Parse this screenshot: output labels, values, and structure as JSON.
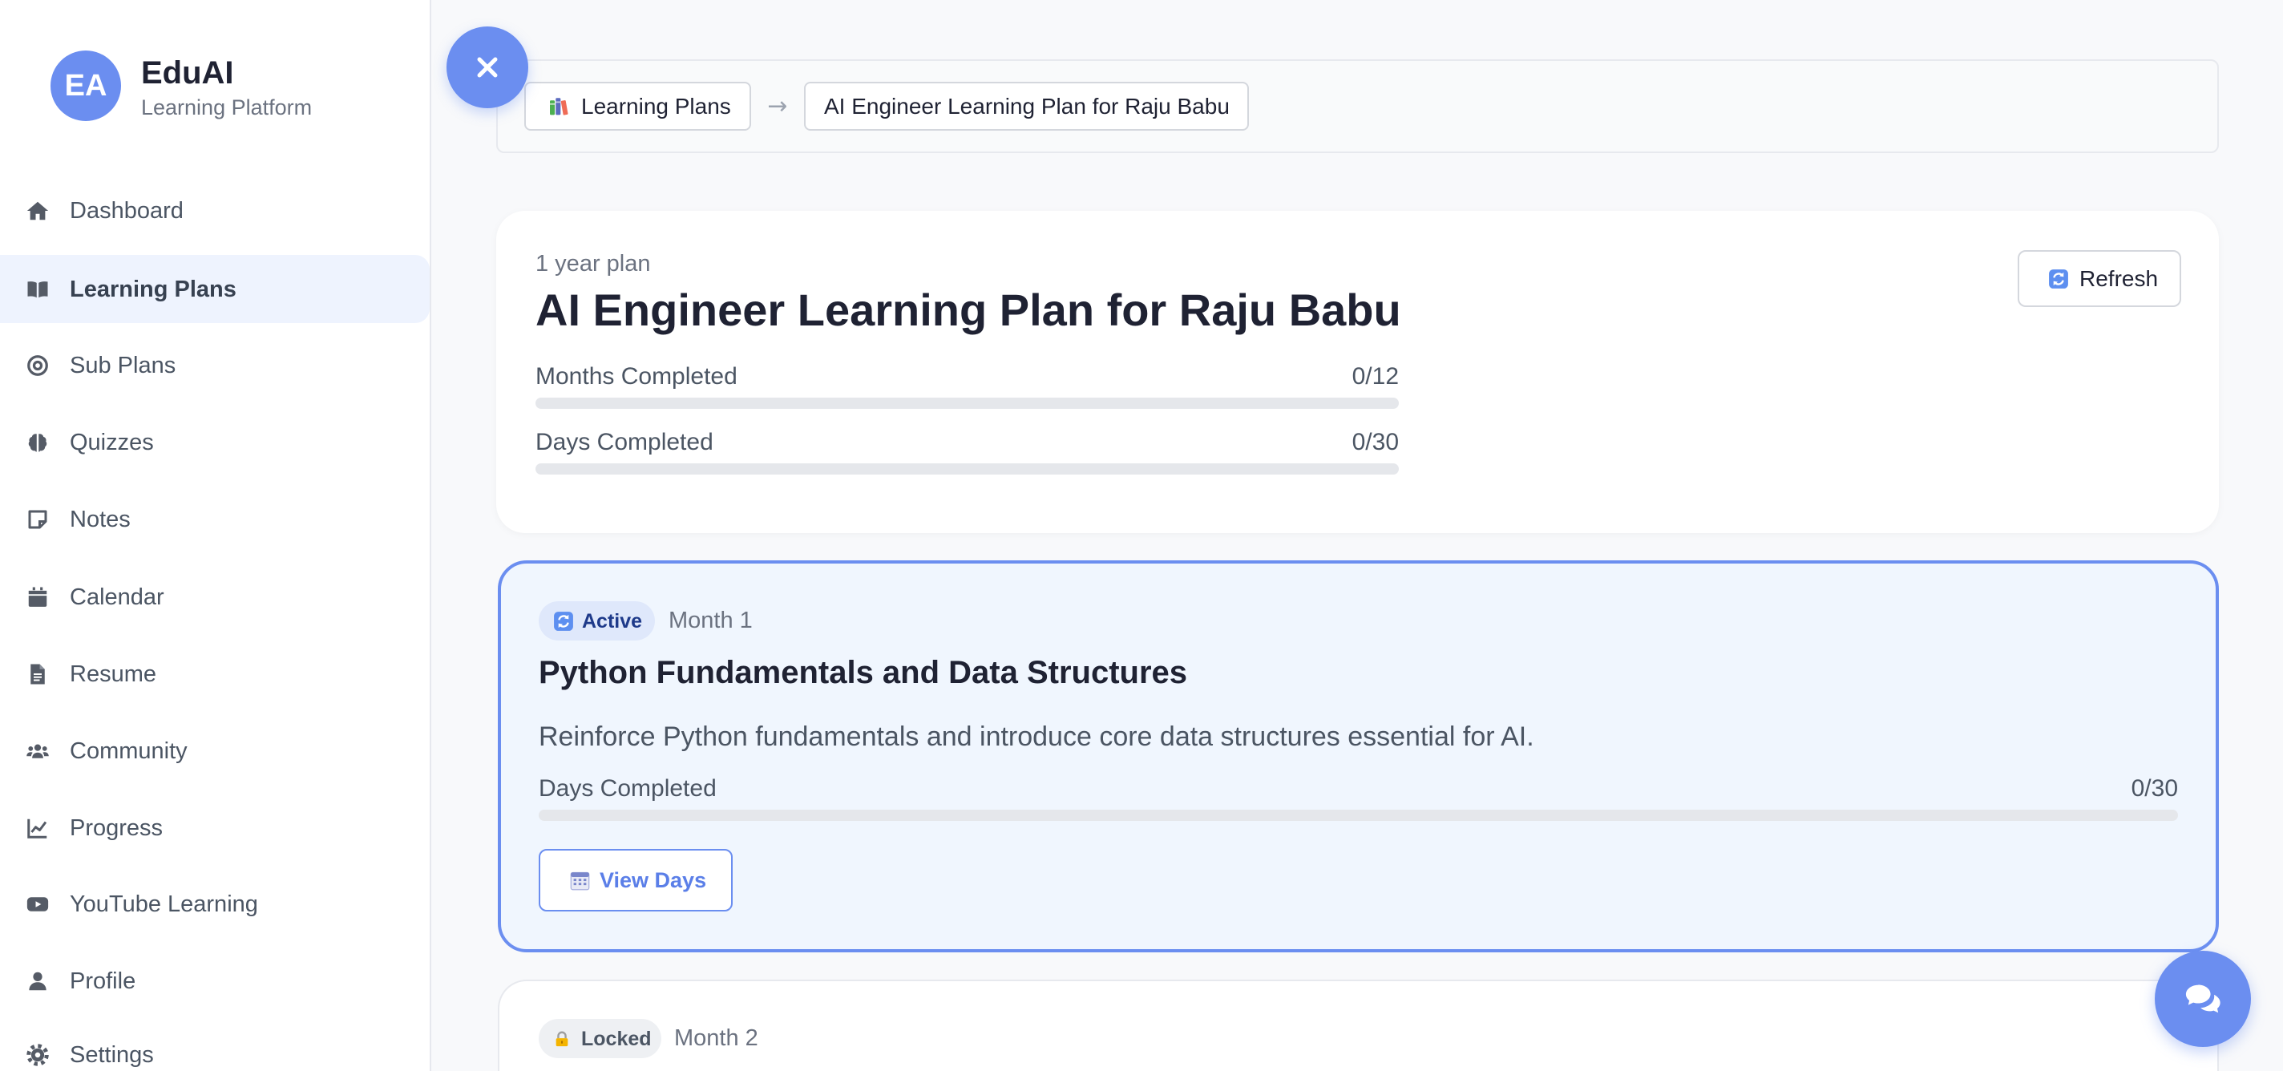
{
  "app": {
    "logo_initials": "EA",
    "name": "EduAI",
    "tagline": "Learning Platform"
  },
  "sidebar": {
    "items": [
      {
        "label": "Dashboard",
        "icon": "home-icon"
      },
      {
        "label": "Learning Plans",
        "icon": "book-open-icon",
        "active": true
      },
      {
        "label": "Sub Plans",
        "icon": "bullseye-icon"
      },
      {
        "label": "Quizzes",
        "icon": "brain-icon"
      },
      {
        "label": "Notes",
        "icon": "sticky-note-icon"
      },
      {
        "label": "Calendar",
        "icon": "calendar-icon"
      },
      {
        "label": "Resume",
        "icon": "file-icon"
      },
      {
        "label": "Community",
        "icon": "users-icon"
      },
      {
        "label": "Progress",
        "icon": "chart-line-icon"
      },
      {
        "label": "YouTube Learning",
        "icon": "youtube-icon"
      },
      {
        "label": "Profile",
        "icon": "user-icon"
      },
      {
        "label": "Settings",
        "icon": "gear-icon"
      }
    ]
  },
  "close_button": {
    "icon": "close-icon"
  },
  "breadcrumb": {
    "items": [
      {
        "label": "Learning Plans",
        "icon": "books-icon"
      },
      {
        "label": "AI Engineer Learning Plan for Raju Babu"
      }
    ],
    "separator": "→"
  },
  "plan": {
    "duration": "1 year plan",
    "title": "AI Engineer Learning Plan for Raju Babu",
    "refresh": {
      "label": "Refresh",
      "icon": "refresh-icon"
    },
    "progress": [
      {
        "label": "Months Completed",
        "value": "0/12",
        "fraction": 0
      },
      {
        "label": "Days Completed",
        "value": "0/30",
        "fraction": 0
      }
    ]
  },
  "months": [
    {
      "status": "Active",
      "status_icon": "refresh-icon",
      "month": "Month 1",
      "title": "Python Fundamentals and Data Structures",
      "description": "Reinforce Python fundamentals and introduce core data structures essential for AI.",
      "progress": {
        "label": "Days Completed",
        "value": "0/30",
        "fraction": 0
      },
      "action": {
        "label": "View Days",
        "icon": "calendar-icon"
      }
    },
    {
      "status": "Locked",
      "status_icon": "lock-icon",
      "month": "Month 2"
    }
  ],
  "chat_button": {
    "icon": "comments-icon"
  },
  "colors": {
    "accent": "#6b8ef0",
    "page_bg": "#f8f9fb",
    "active_nav_bg": "#eef3fe",
    "active_card_bg": "#f0f6fe",
    "active_badge_bg": "#dfe8fb",
    "locked_badge_bg": "#eef0f3",
    "progress_track": "#e5e7eb"
  }
}
